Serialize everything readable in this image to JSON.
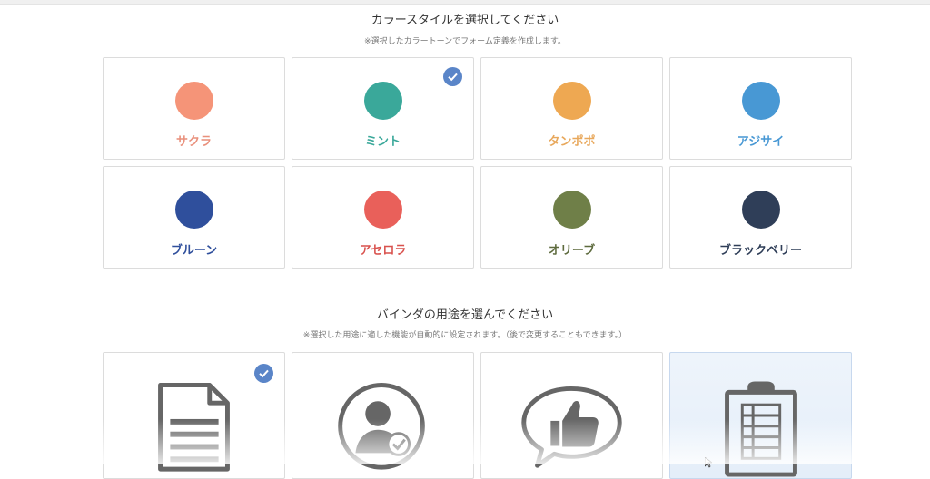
{
  "color_section": {
    "title": "カラースタイルを選択してください",
    "note": "※選択したカラートーンでフォーム定義を作成します。",
    "options": [
      {
        "label": "サクラ",
        "color": "#f59478",
        "selected": false
      },
      {
        "label": "ミント",
        "color": "#3aa89a",
        "selected": true
      },
      {
        "label": "タンポポ",
        "color": "#eea852",
        "selected": false
      },
      {
        "label": "アジサイ",
        "color": "#4898d4",
        "selected": false
      },
      {
        "label": "ブルーン",
        "color": "#2f4f9c",
        "selected": false
      },
      {
        "label": "アセロラ",
        "color": "#e9605a",
        "selected": false
      },
      {
        "label": "オリーブ",
        "color": "#6f7f48",
        "selected": false
      },
      {
        "label": "ブラックベリー",
        "color": "#2f3e58",
        "selected": false
      }
    ]
  },
  "purpose_section": {
    "title": "バインダの用途を選んでください",
    "note": "※選択した用途に適した機能が自動的に設定されます。（後で変更することもできます。）",
    "options": [
      {
        "icon": "document-icon",
        "selected": true
      },
      {
        "icon": "user-check-icon",
        "selected": false
      },
      {
        "icon": "thumbs-up-speech-icon",
        "selected": false
      },
      {
        "icon": "clipboard-table-icon",
        "selected": false
      }
    ]
  },
  "colors": {
    "check_badge": "#5a85c8",
    "icon_gray": "#666666",
    "hover_bg": "#e8f1fb"
  }
}
